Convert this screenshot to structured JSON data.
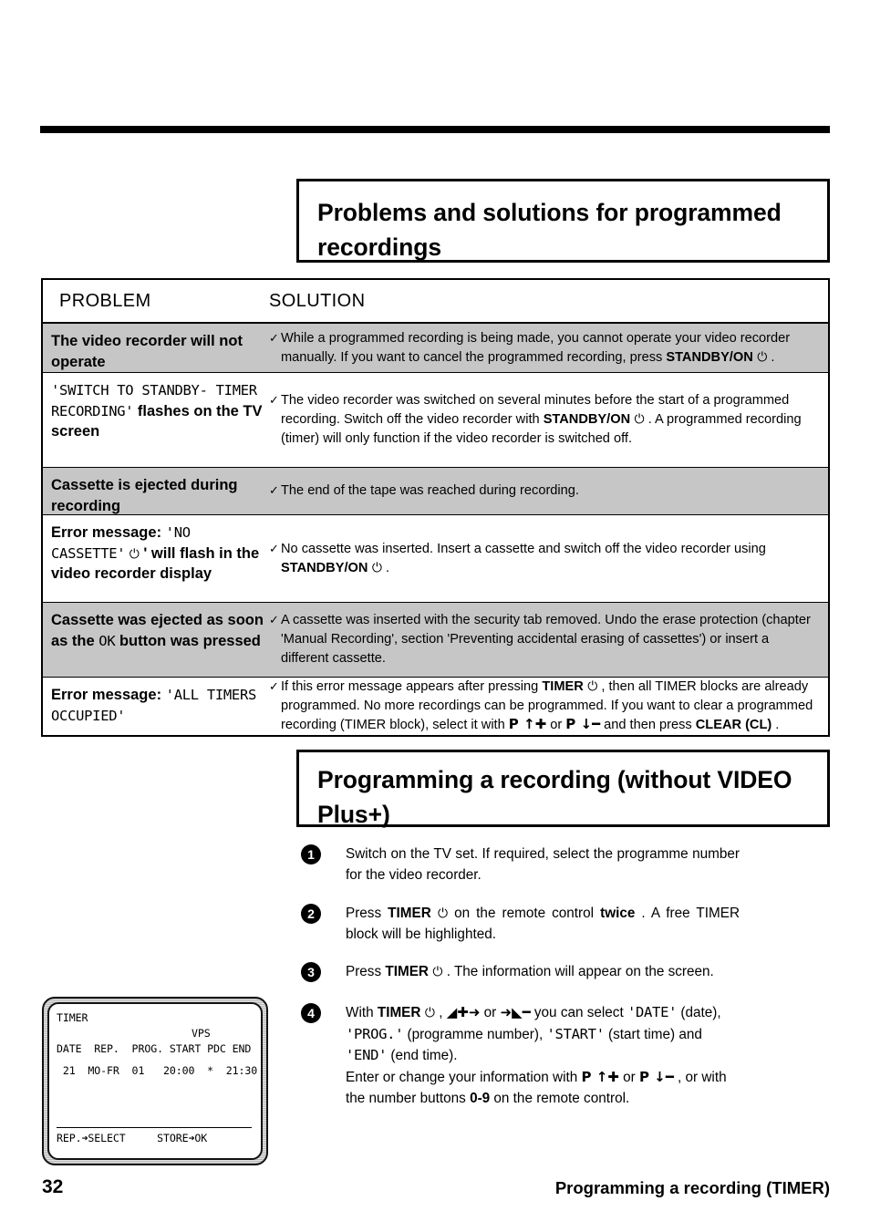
{
  "page": {
    "number": "32",
    "footer_title": "Programming a recording (TIMER)"
  },
  "sections": {
    "problems": {
      "heading": "Problems and solutions for programmed recordings"
    },
    "programming": {
      "heading": "Programming a recording (without VIDEO Plus+)"
    }
  },
  "table": {
    "headers": {
      "problem": "PROBLEM",
      "solution": "SOLUTION"
    },
    "check_glyph": "✓",
    "rows": [
      {
        "shaded": true,
        "problem": {
          "parts": [
            {
              "text": "The video recorder will not operate",
              "style": "bold"
            }
          ]
        },
        "solution": {
          "parts": [
            {
              "text": "While a programmed recording is being made, you cannot operate your video recorder manually. If you want to cancel the programmed recording, press ",
              "style": "normal"
            },
            {
              "text": "STANDBY/ON",
              "style": "bold"
            },
            {
              "text": " ⏻",
              "style": "power"
            },
            {
              "text": " .",
              "style": "normal"
            }
          ]
        }
      },
      {
        "shaded": false,
        "problem": {
          "parts": [
            {
              "text": "'SWITCH TO STANDBY- TIMER RECORDING'",
              "style": "mono"
            },
            {
              "text": " flashes on the TV screen",
              "style": "bold"
            }
          ]
        },
        "solution": {
          "parts": [
            {
              "text": "The video recorder was switched on several minutes before the start of a programmed recording. Switch off the video recorder with ",
              "style": "normal"
            },
            {
              "text": "STANDBY/ON",
              "style": "bold"
            },
            {
              "text": " ⏻",
              "style": "power"
            },
            {
              "text": " . A programmed recording (timer) will only function if the video recorder is switched off.",
              "style": "normal"
            }
          ]
        }
      },
      {
        "shaded": true,
        "problem": {
          "parts": [
            {
              "text": "Cassette is ejected during recording",
              "style": "bold"
            }
          ]
        },
        "solution": {
          "parts": [
            {
              "text": "The end of the tape was reached during recording.",
              "style": "normal"
            }
          ]
        }
      },
      {
        "shaded": false,
        "problem": {
          "parts": [
            {
              "text": "Error message: ",
              "style": "bold"
            },
            {
              "text": "'NO CASSETTE'",
              "style": "mono"
            },
            {
              "text": " ⏻",
              "style": "power"
            },
            {
              "text": " ' will flash in the video recorder display",
              "style": "bold"
            }
          ]
        },
        "solution": {
          "parts": [
            {
              "text": "No cassette was inserted. Insert a cassette and switch off the video recorder using ",
              "style": "normal"
            },
            {
              "text": "STANDBY/ON",
              "style": "bold"
            },
            {
              "text": " ⏻",
              "style": "power"
            },
            {
              "text": " .",
              "style": "normal"
            }
          ]
        }
      },
      {
        "shaded": true,
        "problem": {
          "parts": [
            {
              "text": "Cassette was ejected as soon as the ",
              "style": "bold"
            },
            {
              "text": "OK",
              "style": "mono"
            },
            {
              "text": " button was pressed",
              "style": "bold"
            }
          ]
        },
        "solution": {
          "parts": [
            {
              "text": "A cassette was inserted with the security tab removed. Undo the erase protection (chapter 'Manual Recording', section 'Preventing accidental erasing of cassettes') or insert a different cassette.",
              "style": "normal"
            }
          ]
        }
      },
      {
        "shaded": false,
        "problem": {
          "parts": [
            {
              "text": "Error message: ",
              "style": "bold"
            },
            {
              "text": "'ALL TIMERS OCCUPIED'",
              "style": "mono"
            }
          ]
        },
        "solution": {
          "parts": [
            {
              "text": "If this error message appears after pressing ",
              "style": "normal"
            },
            {
              "text": "TIMER",
              "style": "bold"
            },
            {
              "text": " ⏻",
              "style": "power"
            },
            {
              "text": " , then all TIMER blocks are already programmed. No more recordings can be programmed. If you want to clear a programmed recording (TIMER block), select it with ",
              "style": "normal"
            },
            {
              "text": "P ↑✚",
              "style": "arrow"
            },
            {
              "text": " or ",
              "style": "normal"
            },
            {
              "text": "P ↓━",
              "style": "arrow"
            },
            {
              "text": " and then press ",
              "style": "normal"
            },
            {
              "text": "CLEAR (CL)",
              "style": "bold"
            },
            {
              "text": " .",
              "style": "normal"
            }
          ]
        }
      }
    ]
  },
  "steps": [
    {
      "number": "1",
      "parts": [
        {
          "text": "Switch on the TV set. If required, select the programme number for the video recorder.",
          "style": "normal"
        }
      ]
    },
    {
      "number": "2",
      "parts": [
        {
          "text": "Press ",
          "style": "normal"
        },
        {
          "text": "TIMER",
          "style": "bold"
        },
        {
          "text": " ⏻",
          "style": "power"
        },
        {
          "text": " on the remote control ",
          "style": "normal"
        },
        {
          "text": "twice",
          "style": "bold"
        },
        {
          "text": " . A free TIMER block will be highlighted.",
          "style": "normal"
        }
      ]
    },
    {
      "number": "3",
      "parts": [
        {
          "text": "Press ",
          "style": "normal"
        },
        {
          "text": "TIMER",
          "style": "bold"
        },
        {
          "text": " ⏻",
          "style": "power"
        },
        {
          "text": " . The information will appear on the screen.",
          "style": "normal"
        }
      ]
    },
    {
      "number": "4",
      "parts": [
        {
          "text": "With ",
          "style": "normal"
        },
        {
          "text": "TIMER",
          "style": "bold"
        },
        {
          "text": " ⏻",
          "style": "power"
        },
        {
          "text": " ,  ",
          "style": "normal"
        },
        {
          "text": "◢✚➜",
          "style": "arrow"
        },
        {
          "text": " or ",
          "style": "normal"
        },
        {
          "text": "➜◣━",
          "style": "arrow"
        },
        {
          "text": " you can select ",
          "style": "normal"
        },
        {
          "text": "'DATE'",
          "style": "mono"
        },
        {
          "text": " (date), ",
          "style": "normal"
        },
        {
          "text": "'PROG.'",
          "style": "mono"
        },
        {
          "text": " (programme number), ",
          "style": "normal"
        },
        {
          "text": "'START'",
          "style": "mono"
        },
        {
          "text": " (start time) and ",
          "style": "normal"
        },
        {
          "text": "'END'",
          "style": "mono"
        },
        {
          "text": " (end time).",
          "style": "normal"
        },
        {
          "text": "\nEnter or change your information with ",
          "style": "normal"
        },
        {
          "text": "P ↑✚",
          "style": "arrow"
        },
        {
          "text": " or ",
          "style": "normal"
        },
        {
          "text": "P ↓━",
          "style": "arrow"
        },
        {
          "text": " , or with the number buttons ",
          "style": "normal"
        },
        {
          "text": "0-9",
          "style": "bold"
        },
        {
          "text": " on the remote control.",
          "style": "normal"
        }
      ]
    }
  ],
  "tv_screen": {
    "title": "TIMER",
    "vps_label": "VPS",
    "columns": "DATE  REP.  PROG. START PDC END",
    "entry": " 21  MO-FR  01   20:00  *  21:30",
    "footer": "REP.➜SELECT     STORE➜OK"
  }
}
